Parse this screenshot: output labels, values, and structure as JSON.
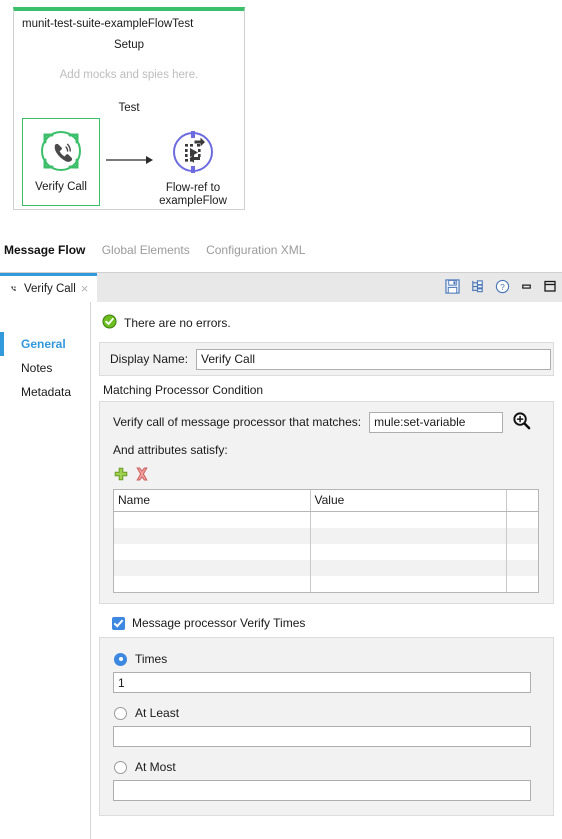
{
  "flow": {
    "title": "munit-test-suite-exampleFlowTest",
    "setup_label": "Setup",
    "setup_placeholder": "Add mocks and spies here.",
    "test_label": "Test",
    "accent_color": "#3cbf6b",
    "nodes": [
      {
        "label": "Verify Call",
        "icon": "verify-call-icon",
        "color": "#3cbf6b"
      },
      {
        "label": "Flow-ref to exampleFlow",
        "icon": "flow-ref-icon",
        "color": "#6c6ce0"
      }
    ]
  },
  "editor_tabs": [
    {
      "label": "Message Flow",
      "active": true
    },
    {
      "label": "Global Elements",
      "active": false
    },
    {
      "label": "Configuration XML",
      "active": false
    }
  ],
  "properties": {
    "tab": {
      "label": "Verify Call",
      "icon": "verify-call-icon",
      "close": "×"
    },
    "toolbar": [
      {
        "name": "save-icon"
      },
      {
        "name": "hierarchy-icon"
      },
      {
        "name": "help-icon"
      },
      {
        "name": "minimize-icon"
      },
      {
        "name": "maximize-icon"
      }
    ],
    "side_nav": [
      {
        "label": "General",
        "active": true
      },
      {
        "label": "Notes",
        "active": false
      },
      {
        "label": "Metadata",
        "active": false
      }
    ],
    "status": {
      "text": "There are no errors.",
      "icon": "success-icon",
      "color": "#5aa81d"
    },
    "display_name": {
      "label": "Display Name:",
      "value": "Verify Call",
      "placeholder": ""
    },
    "matching": {
      "group_label": "Matching Processor Condition",
      "processor_label": "Verify call of message processor that matches:",
      "processor_value": "mule:set-variable",
      "processor_placeholder": "",
      "browse_icon": "search-plus-icon",
      "attributes_label": "And attributes satisfy:",
      "add_icon": "add-icon",
      "delete_icon": "delete-icon",
      "table": {
        "columns": [
          "Name",
          "Value",
          ""
        ],
        "rows": [
          [
            "",
            "",
            ""
          ],
          [
            "",
            "",
            ""
          ],
          [
            "",
            "",
            ""
          ],
          [
            "",
            "",
            ""
          ],
          [
            "",
            "",
            ""
          ]
        ]
      }
    },
    "verify_times": {
      "checkbox_label": "Message processor Verify Times",
      "checked": true,
      "options": [
        {
          "label": "Times",
          "selected": true,
          "value": "1",
          "placeholder": ""
        },
        {
          "label": "At Least",
          "selected": false,
          "value": "",
          "placeholder": ""
        },
        {
          "label": "At Most",
          "selected": false,
          "value": "",
          "placeholder": ""
        }
      ]
    }
  },
  "colors": {
    "accent_blue": "#3399dd",
    "selection_blue": "#3d88e0",
    "green": "#3cbf6b",
    "purple": "#6c6ce0"
  }
}
